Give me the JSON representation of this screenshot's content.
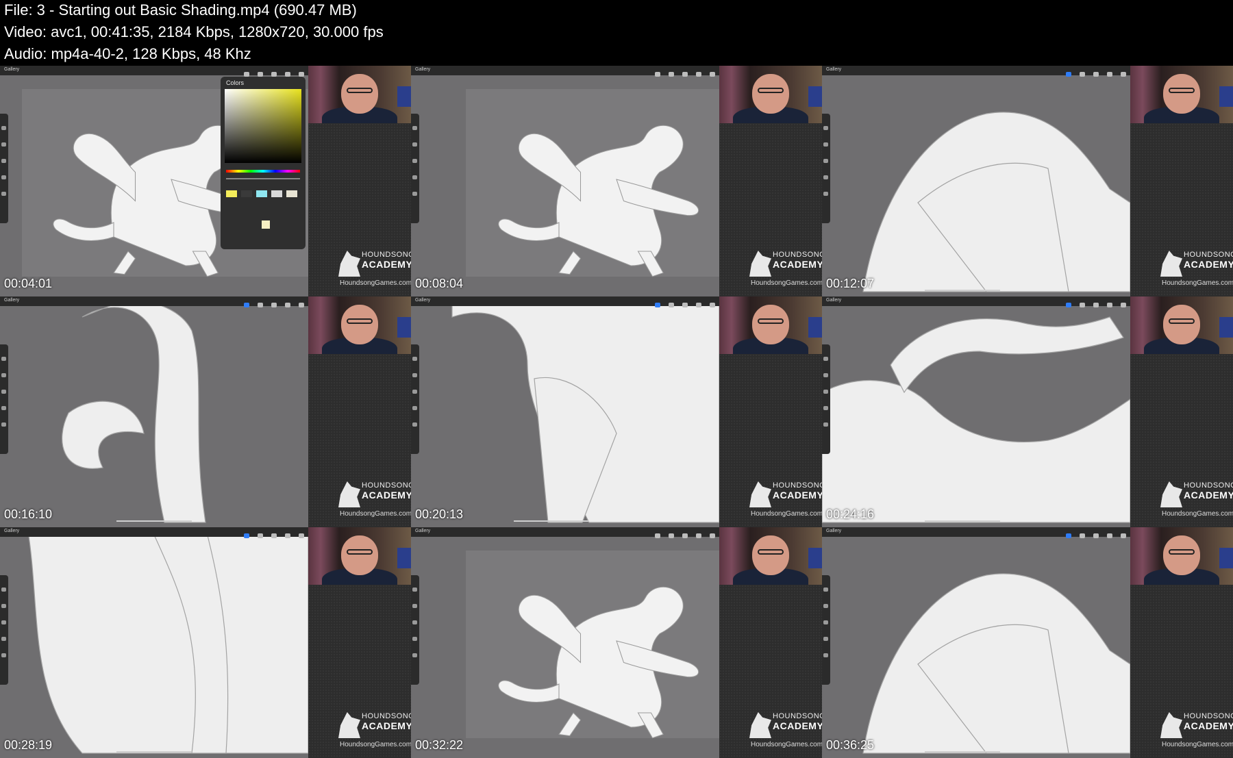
{
  "header": {
    "file": "File: 3 - Starting out Basic Shading.mp4 (690.47 MB)",
    "video": "Video: avc1, 00:41:35, 2184 Kbps, 1280x720, 30.000 fps",
    "audio": "Audio: mp4a-40-2, 128 Kbps, 48 Khz"
  },
  "app": {
    "gallery_label": "Gallery"
  },
  "logo": {
    "line1": "HOUNDSONG",
    "line2": "ACADEMY",
    "site": "HoundsongGames.com"
  },
  "colors_panel": {
    "title": "Colors",
    "swatches": [
      "#f4ec5a",
      "#3a3a3a",
      "#8fe6f0",
      "#d8d8d8",
      "#e8e4d4"
    ]
  },
  "thumbnails": [
    {
      "timestamp": "00:04:01",
      "view": "full",
      "colors_open": true
    },
    {
      "timestamp": "00:08:04",
      "view": "full",
      "colors_open": false
    },
    {
      "timestamp": "00:12:07",
      "view": "zoom",
      "colors_open": false
    },
    {
      "timestamp": "00:16:10",
      "view": "zoom",
      "colors_open": false
    },
    {
      "timestamp": "00:20:13",
      "view": "zoom",
      "colors_open": false
    },
    {
      "timestamp": "00:24:16",
      "view": "zoom",
      "colors_open": false
    },
    {
      "timestamp": "00:28:19",
      "view": "zoom",
      "colors_open": false
    },
    {
      "timestamp": "00:32:22",
      "view": "full",
      "colors_open": false
    },
    {
      "timestamp": "00:36:25",
      "view": "zoom",
      "colors_open": false
    }
  ]
}
